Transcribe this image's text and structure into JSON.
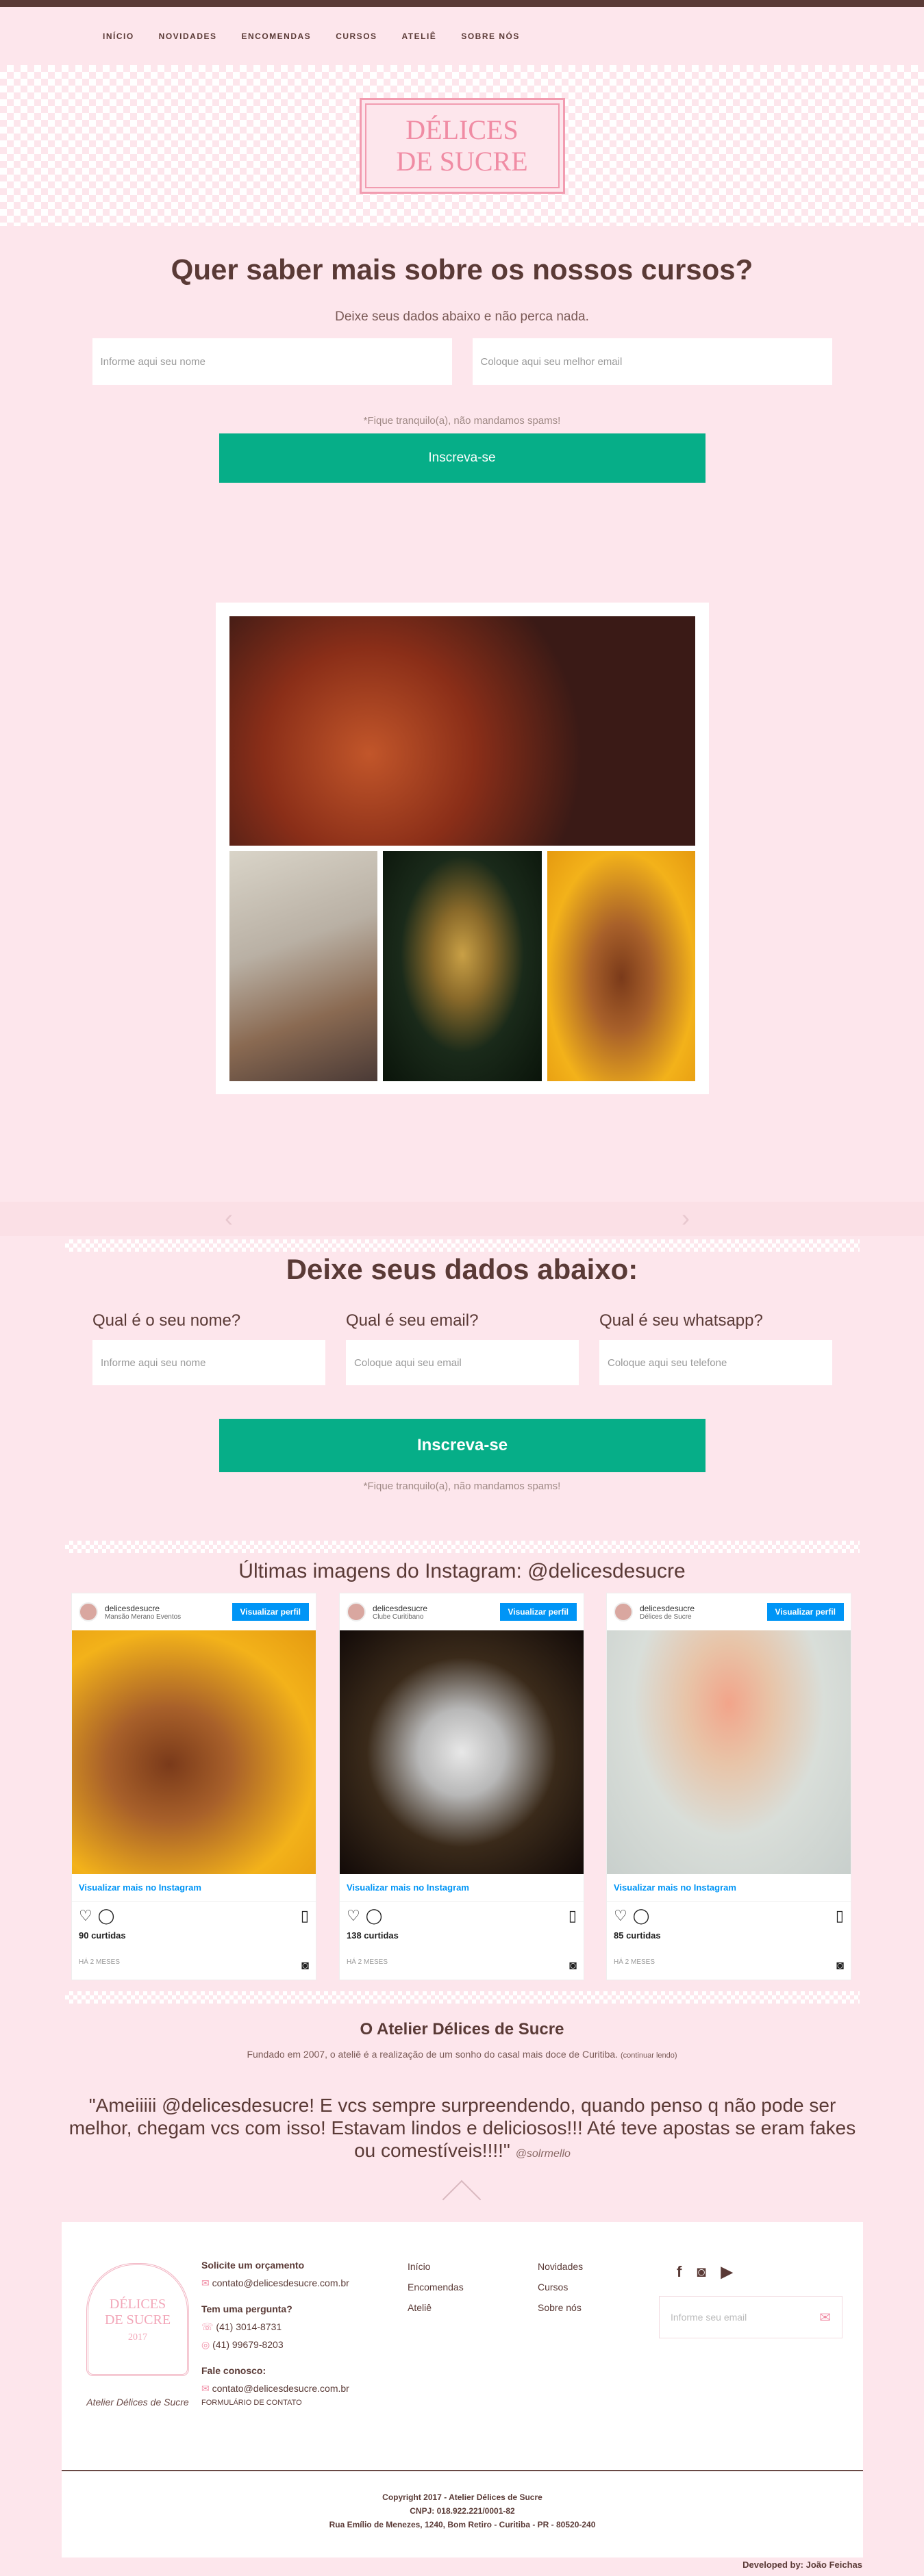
{
  "nav": {
    "items": [
      "INÍCIO",
      "NOVIDADES",
      "ENCOMENDAS",
      "CURSOS",
      "ATELIÊ",
      "SOBRE NÓS"
    ]
  },
  "logo": {
    "line1": "DÉLICES",
    "line2": "DE SUCRE"
  },
  "courses": {
    "title": "Quer saber mais sobre os nossos cursos?",
    "subtitle": "Deixe seus dados abaixo e não perca nada.",
    "name_placeholder": "Informe aqui seu nome",
    "email_placeholder": "Coloque aqui seu melhor email",
    "note": "*Fique tranquilo(a), não mandamos spams!",
    "button": "Inscreva-se"
  },
  "form2": {
    "title": "Deixe seus dados abaixo:",
    "name_label": "Qual é o seu nome?",
    "name_placeholder": "Informe aqui seu nome",
    "email_label": "Qual é seu email?",
    "email_placeholder": "Coloque aqui seu email",
    "whats_label": "Qual é seu whatsapp?",
    "whats_placeholder": "Coloque aqui seu telefone",
    "button": "Inscreva-se",
    "note": "*Fique tranquilo(a), não mandamos spams!"
  },
  "instagram": {
    "title": "Últimas imagens do Instagram: @delicesdesucre",
    "cards": [
      {
        "user": "delicesdesucre",
        "location": "Mansão Merano Eventos",
        "button": "Visualizar perfil",
        "link": "Visualizar mais no Instagram",
        "likes": "90 curtidas",
        "ago": "HÁ 2 MESES"
      },
      {
        "user": "delicesdesucre",
        "location": "Clube Curitibano",
        "button": "Visualizar perfil",
        "link": "Visualizar mais no Instagram",
        "likes": "138 curtidas",
        "ago": "HÁ 2 MESES"
      },
      {
        "user": "delicesdesucre",
        "location": "Délices de Sucre",
        "button": "Visualizar perfil",
        "link": "Visualizar mais no Instagram",
        "likes": "85 curtidas",
        "ago": "HÁ 2 MESES"
      }
    ]
  },
  "about": {
    "title": "O Atelier Délices de Sucre",
    "text": "Fundado em 2007, o ateliê é a realização de um sonho do casal mais doce de Curitiba.",
    "more": "(continuar lendo)"
  },
  "testimonial": {
    "quote": "\"Ameiiiii @delicesdesucre! E vcs sempre surpreendendo, quando penso q não pode ser melhor, chegam vcs com isso! Estavam lindos e deliciosos!!! Até teve apostas se eram fakes ou comestíveis!!!!\"",
    "author": "@solrmello"
  },
  "footer": {
    "logo_line1": "DÉLICES",
    "logo_line2": "DE SUCRE",
    "logo_year": "2017",
    "caption": "Atelier Délices de Sucre",
    "quote_title": "Solicite um orçamento",
    "quote_email": "contato@delicesdesucre.com.br",
    "question_title": "Tem uma pergunta?",
    "phone1": "(41) 3014-8731",
    "phone2": "(41) 99679-8203",
    "talk_title": "Fale conosco:",
    "talk_email": "contato@delicesdesucre.com.br",
    "form_link": "FORMULÁRIO DE CONTATO",
    "links_col1": [
      "Início",
      "Encomendas",
      "Ateliê"
    ],
    "links_col2": [
      "Novidades",
      "Cursos",
      "Sobre nós"
    ],
    "newsletter_placeholder": "Informe seu email",
    "copyright": "Copyright 2017 - Atelier Délices de Sucre",
    "cnpj": "CNPJ: 018.922.221/0001-82",
    "address": "Rua Emílio de Menezes, 1240, Bom Retiro - Curitiba - PR - 80520-240",
    "developer": "Developed by: João Feichas"
  }
}
